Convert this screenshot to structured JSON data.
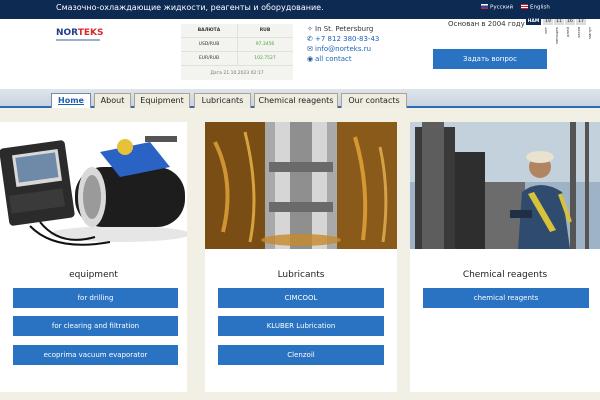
{
  "topbar": {
    "tagline": "Смазочно-охлаждающие жидкости, реагенты и оборудование.",
    "lang_ru": "Русский",
    "lang_en": "English"
  },
  "logo": {
    "part1": "NOR",
    "part2": "TEKS"
  },
  "rates": {
    "header_currency": "ВАЛЮТА",
    "header_rub": "RUB",
    "rows": [
      {
        "pair": "USD/RUB",
        "value": "97.3456"
      },
      {
        "pair": "EUR/RUB",
        "value": "102.7527"
      }
    ],
    "date": "Дата 21.10.2023 02:17"
  },
  "contacts": {
    "city": "In St. Petersburg",
    "phone": "+7 812 380-83-43",
    "email": "info@norteks.ru",
    "all_contact": "all contact"
  },
  "founded": "Основан в 2004 году",
  "counter": {
    "label": "НАМ",
    "numbers": [
      "19",
      "11",
      "16",
      "17"
    ],
    "units": [
      "лет",
      "месяцев",
      "дней",
      "часов",
      "минут"
    ]
  },
  "ask_button": "Задать вопрос",
  "nav": {
    "tabs": [
      "Home",
      "About",
      "Equipment",
      "Lubricants",
      "Chemical reagents",
      "Our contacts"
    ]
  },
  "cards": [
    {
      "title": "equipment",
      "buttons": [
        "for drilling",
        "for clearing and filtration",
        "ecoprima vacuum evaporator"
      ]
    },
    {
      "title": "Lubricants",
      "buttons": [
        "CIMCOOL",
        "KLUBER Lubrication",
        "Clenzoil"
      ]
    },
    {
      "title": "Chemical reagents",
      "buttons": [
        "chemical reagents"
      ]
    }
  ],
  "colors": {
    "topbar": "#0d2a52",
    "accent_button": "#2a72c2",
    "page_background": "#f2f0e4",
    "active_tab_text": "#1c5eb0"
  }
}
